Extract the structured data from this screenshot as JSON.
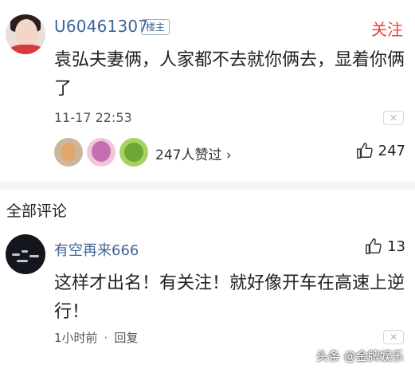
{
  "main_comment": {
    "username": "U60461307",
    "badge": "楼主",
    "follow_label": "关注",
    "content": "袁弘夫妻俩，人家都不去就你俩去，显着你俩了",
    "timestamp": "11-17 22:53",
    "likers_text": "247人赞过",
    "like_count": "247"
  },
  "section_title": "全部评论",
  "reply": {
    "username": "有空再来666",
    "like_count": "13",
    "content": "这样才出名！有关注！就好像开车在高速上逆行！",
    "time": "1小时前",
    "separator": "·",
    "reply_label": "回复"
  },
  "watermark": "头条 @金牌娱乐",
  "colors": {
    "username": "#406599",
    "follow": "#f04142",
    "divider": "#f4f5f6"
  }
}
